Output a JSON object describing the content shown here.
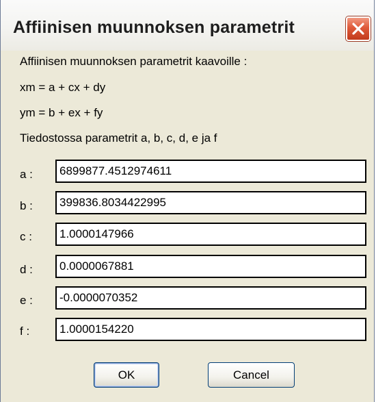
{
  "window": {
    "title": "Affiinisen muunnoksen parametrit",
    "close_icon": "close-icon"
  },
  "text": {
    "intro": "Affiinisen muunnoksen parametrit kaavoille :",
    "formula_x": "xm = a + cx + dy",
    "formula_y": "ym = b + ex + fy",
    "file_note": "Tiedostossa parametrit a, b, c, d, e ja f"
  },
  "fields": [
    {
      "label": "a :",
      "value": "6899877.4512974611"
    },
    {
      "label": "b :",
      "value": "399836.8034422995"
    },
    {
      "label": "c :",
      "value": "1.0000147966"
    },
    {
      "label": "d :",
      "value": "0.0000067881"
    },
    {
      "label": "e :",
      "value": "-0.0000070352"
    },
    {
      "label": "f :",
      "value": "1.0000154220"
    }
  ],
  "buttons": {
    "ok": "OK",
    "cancel": "Cancel"
  },
  "colors": {
    "dialog_bg": "#ece9d8",
    "close_button": "#d9532f",
    "button_border": "#003c74"
  }
}
